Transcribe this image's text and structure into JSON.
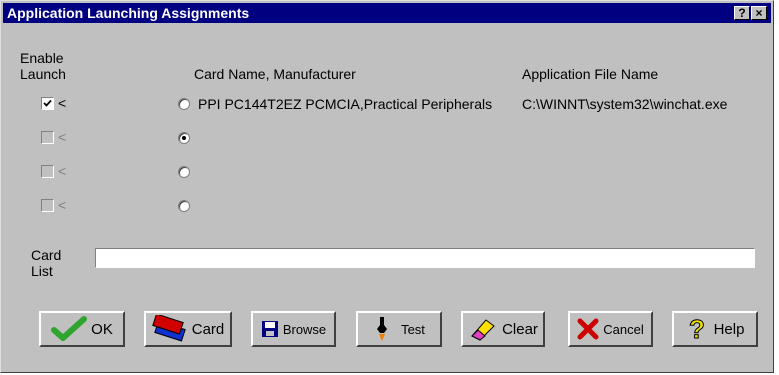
{
  "window": {
    "title": "Application Launching Assignments",
    "help_button": "?",
    "close_button": "×"
  },
  "headers": {
    "enable_launch_line1": "Enable",
    "enable_launch_line2": "Launch",
    "card_name": "Card Name, Manufacturer",
    "app_file": "Application File Name"
  },
  "rows": [
    {
      "enabled": true,
      "arrow": "<",
      "radio_selected": false,
      "card_name": "PPI PC144T2EZ PCMCIA,Practical Peripherals",
      "app_file": "C:\\WINNT\\system32\\winchat.exe"
    },
    {
      "enabled": false,
      "arrow": "<",
      "radio_selected": true,
      "card_name": "",
      "app_file": ""
    },
    {
      "enabled": false,
      "arrow": "<",
      "radio_selected": false,
      "card_name": "",
      "app_file": ""
    },
    {
      "enabled": false,
      "arrow": "<",
      "radio_selected": false,
      "card_name": "",
      "app_file": ""
    }
  ],
  "card_list": {
    "label_line1": "Card",
    "label_line2": "List",
    "value": ""
  },
  "buttons": {
    "ok": "OK",
    "card": "Card",
    "browse": "Browse",
    "test": "Test",
    "clear": "Clear",
    "cancel": "Cancel",
    "help": "Help"
  },
  "colors": {
    "title_bar": "#000080",
    "face": "#c0c0c0",
    "ok_icon": "#2fa52f",
    "cancel_icon": "#cc0000",
    "help_icon": "#f0e000"
  }
}
